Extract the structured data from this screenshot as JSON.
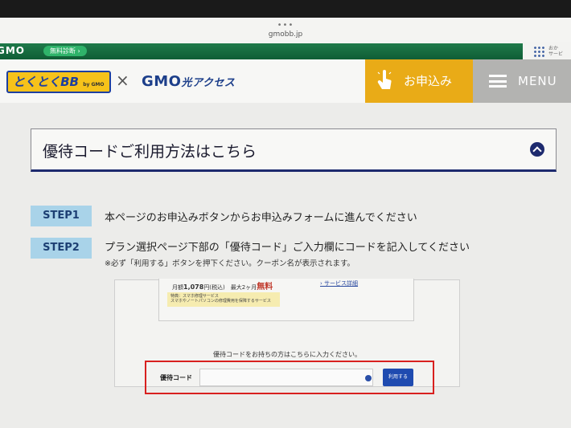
{
  "browser": {
    "url": "gmobb.jp",
    "dots": "•••"
  },
  "gmo_strip": {
    "logo": "GMO",
    "badge": "無料診断 ›",
    "right_text": "おか\nサービ"
  },
  "header": {
    "tokutoku_logo": "とくとくBB",
    "tokutoku_sub": "by GMO",
    "times": "×",
    "gmo_hikari_logo": "GMO",
    "gmo_hikari_sub": "光アクセス",
    "apply_label": "お申込み",
    "menu_label": "MENU"
  },
  "accordion": {
    "title": "優待コードご利用方法はこちら"
  },
  "steps": [
    {
      "label": "STEP1",
      "text": "本ページのお申込みボタンからお申込みフォームに進んでください"
    },
    {
      "label": "STEP2",
      "text": "プラン選択ページ下部の「優待コード」ご入力欄にコードを記入してください",
      "note": "※必ず「利用する」ボタンを押下ください。クーポン名が表示されます。"
    }
  ],
  "embed": {
    "price_prefix": "月額",
    "price_value": "1,078",
    "price_suffix": "円(税込)　最大2ヶ月",
    "price_free": "無料",
    "detail_link": "› サービス詳細",
    "tokuten": "特典：スマホ修理サービス\nスマホやノートパソコンの修理費用を保障するサービス",
    "instruction": "優待コードをお持ちの方はこちらに入力ください。",
    "code_label": "優待コード",
    "code_value": "",
    "use_button": "利用する"
  },
  "colors": {
    "gmo_green": "#0f5d35",
    "apply_yellow": "#e9ab17",
    "menu_gray": "#b3b3b1",
    "navy": "#1d2a6e",
    "step_blue": "#a9d3e9",
    "highlight_red": "#d8201f",
    "button_blue": "#1f4bb0"
  }
}
